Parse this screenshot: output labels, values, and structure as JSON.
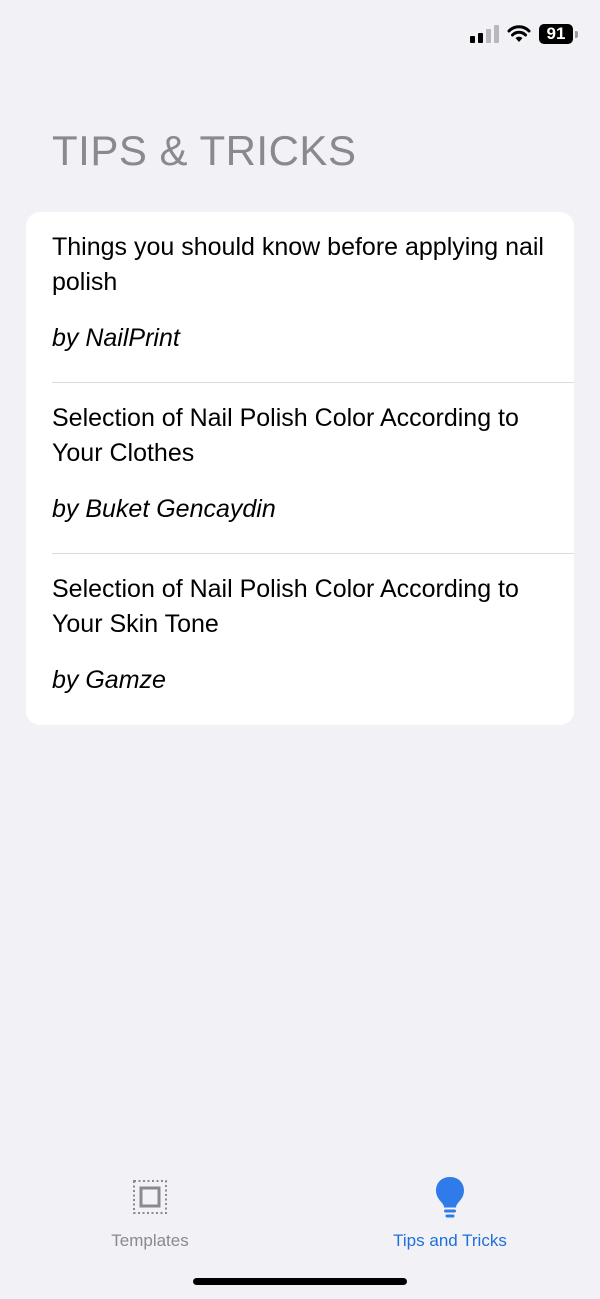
{
  "status_bar": {
    "battery_level": "91",
    "icons": [
      "cellular-signal-icon",
      "wifi-icon",
      "battery-icon"
    ]
  },
  "page": {
    "title": "TIPS & TRICKS"
  },
  "tips": [
    {
      "title": "Things you should know before applying nail polish",
      "author": "by NailPrint"
    },
    {
      "title": "Selection of Nail Polish Color According to Your Clothes",
      "author": "by Buket Gencaydin"
    },
    {
      "title": "Selection of Nail Polish Color According to Your Skin Tone",
      "author": "by Gamze"
    }
  ],
  "tab_bar": {
    "tabs": [
      {
        "label": "Templates",
        "icon": "templates-icon",
        "selected": false
      },
      {
        "label": "Tips and Tricks",
        "icon": "lightbulb-icon",
        "selected": true
      }
    ]
  },
  "colors": {
    "background": "#F2F1F6",
    "card": "#FFFFFF",
    "accent": "#1F6FD9",
    "muted": "#8A8A8E"
  }
}
